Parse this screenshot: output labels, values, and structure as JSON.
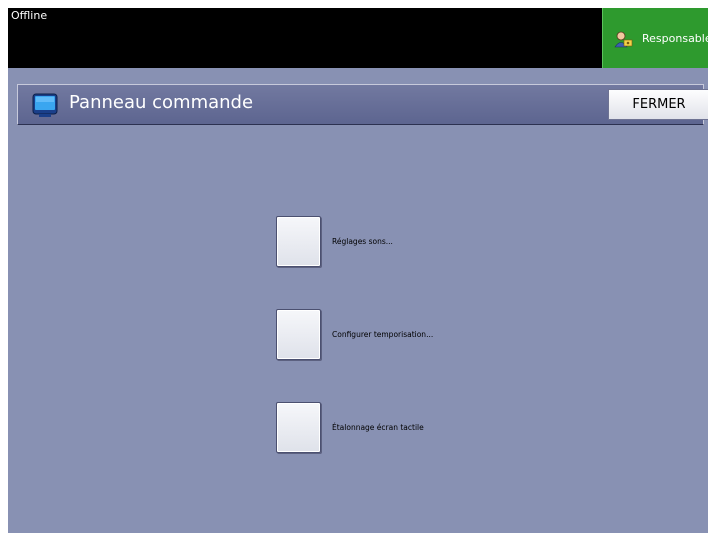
{
  "status": {
    "text": "Offline"
  },
  "user": {
    "label": "Responsable",
    "icon": "user-key-icon"
  },
  "panel": {
    "title": "Panneau commande",
    "icon": "monitor-icon",
    "close_label": "FERMER"
  },
  "options": [
    {
      "label": "Réglages sons..."
    },
    {
      "label": "Configurer temporisation..."
    },
    {
      "label": "Étalonnage écran tactile"
    }
  ],
  "colors": {
    "background": "#8891b3",
    "topbar": "#000000",
    "user_button": "#2e9a2e",
    "title_bar": "#6a719a"
  }
}
